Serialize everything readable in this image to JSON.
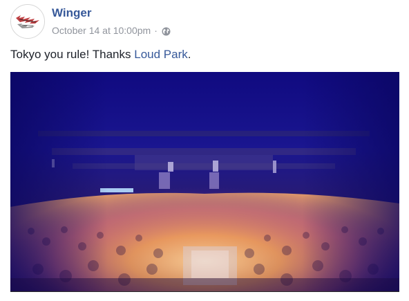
{
  "post": {
    "author": "Winger",
    "timestamp": "October 14 at 10:00pm",
    "separator": "·",
    "privacy_icon": "globe-icon",
    "avatar_logo_text": "Winger",
    "text_prefix": "Tokyo you rule! Thanks ",
    "link_text": "Loud Park",
    "text_suffix": ".",
    "media_type": "video-thumbnail"
  },
  "colors": {
    "link": "#365899",
    "meta": "#90949c",
    "text": "#1d2129",
    "stage_blue": "#14106a",
    "crowd_orange": "#f2a35b"
  }
}
